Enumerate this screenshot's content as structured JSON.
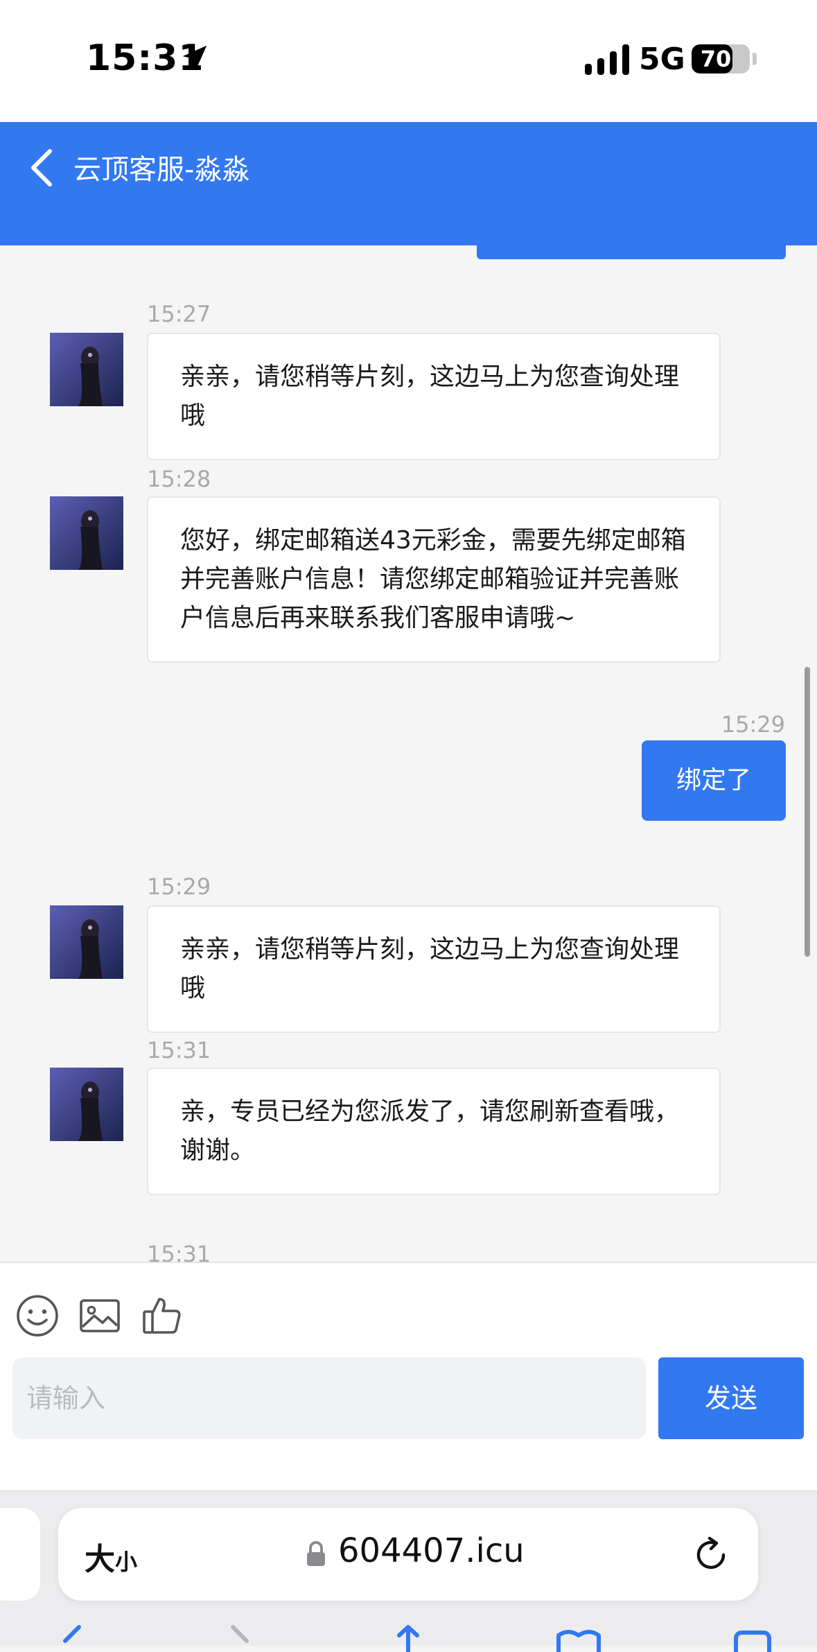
{
  "status_bar": {
    "time": "15:31",
    "network": "5G",
    "battery": "70",
    "battery_level": 0.7
  },
  "header": {
    "title": "云顶客服-淼淼"
  },
  "messages": [
    {
      "side": "left",
      "time": "15:27",
      "text": "亲亲，请您稍等片刻，这边马上为您查询处理哦"
    },
    {
      "side": "left",
      "time": "15:28",
      "text": "您好，绑定邮箱送43元彩金，需要先绑定邮箱并完善账户信息！请您绑定邮箱验证并完善账户信息后再来联系我们客服申请哦~"
    },
    {
      "side": "right",
      "time": "15:29",
      "text": "绑定了"
    },
    {
      "side": "left",
      "time": "15:29",
      "text": "亲亲，请您稍等片刻，这边马上为您查询处理哦"
    },
    {
      "side": "left",
      "time": "15:31",
      "text": "亲，专员已经为您派发了，请您刷新查看哦，谢谢。"
    },
    {
      "side": "left",
      "time": "15:31",
      "text": ""
    }
  ],
  "composer": {
    "placeholder": "请输入",
    "send_label": "发送"
  },
  "toolbar": {
    "icons": [
      "emoji-icon",
      "image-icon",
      "thumbs-up-icon"
    ]
  },
  "browser": {
    "text_size_label": "大",
    "text_size_small": "小",
    "url": "604407.icu"
  },
  "colors": {
    "accent": "#3278f0",
    "background": "#f5f5f6"
  }
}
